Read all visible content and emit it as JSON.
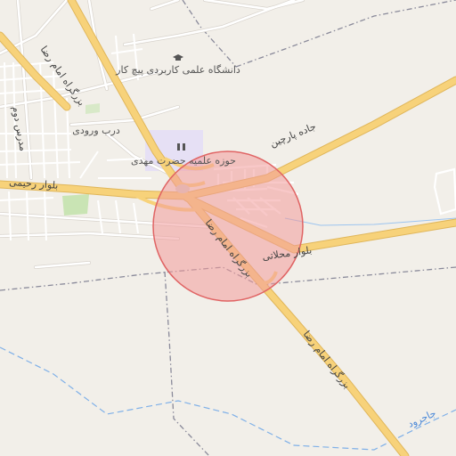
{
  "map": {
    "colors": {
      "background": "#f2efe9",
      "motorway": "#f7d27a",
      "motorway_casing": "#e0b65a",
      "minor_road": "#ffffff",
      "road_casing": "#d8d3cc",
      "boundary": "#8a8a9a",
      "waterway": "#7fb0e8",
      "campus": "#e6e0f5",
      "park": "#c9e4b4",
      "circle_fill": "#f29b9b",
      "circle_stroke": "#e06464"
    },
    "labels": {
      "university": "دانشگاه علمی کاربردی پیچ کار",
      "university_icon": "graduation-cap-icon",
      "seminary": "حوزه علمیه حضرت مهدی",
      "seminary_icon": "religious-school-icon",
      "darb_vorudi": "درب ورودی",
      "madres_dowom": "مدرس دوم",
      "boulevard_rahimi": "بلوار رحیمی",
      "road_parchin": "جاده پارچین",
      "boulevard_mahallati": "بلوار محلاتی",
      "imam_reza_highway": "بزرگراه امام رضا",
      "imam_reza_highway_north": "بزرگراه امام رضا",
      "imam_reza_highway_south": "بزرگراه امام رضا",
      "jajrud": "جاجرود"
    }
  }
}
